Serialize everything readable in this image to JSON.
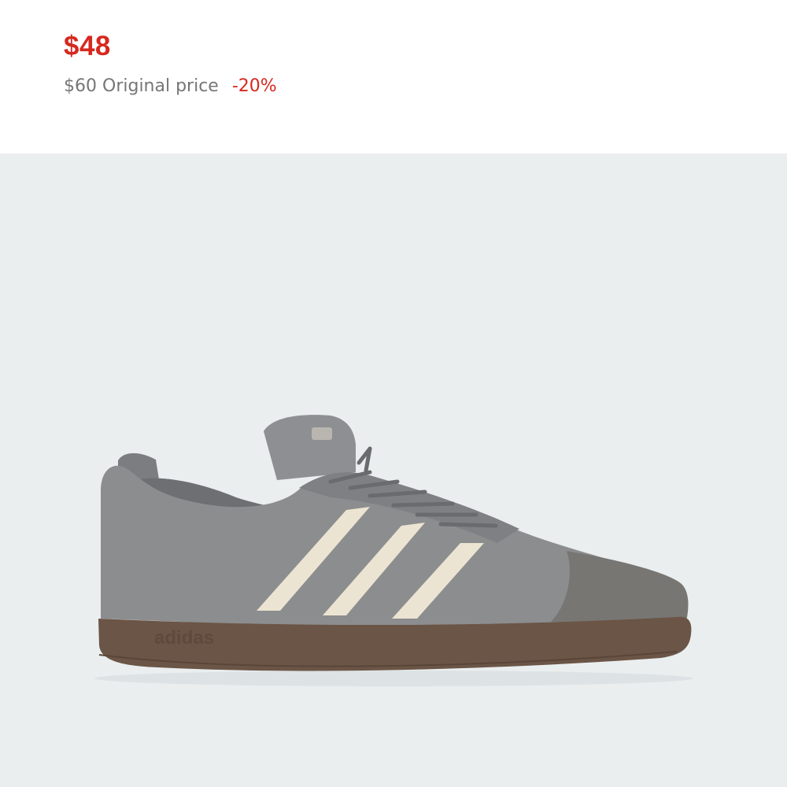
{
  "product": {
    "sale_price": "$48",
    "original_price": "$60",
    "original_price_label": "Original price",
    "discount": "-20%",
    "sole_brand_text": "adidas",
    "image": {
      "description_icon": "sneaker-product-image",
      "background_color": "#eaeeef",
      "upper_color": "#8c8d8f",
      "stripe_color": "#ece4d2",
      "sole_color": "#6b5546"
    }
  },
  "colors": {
    "sale": "#d6281f",
    "muted_text": "#767677"
  }
}
